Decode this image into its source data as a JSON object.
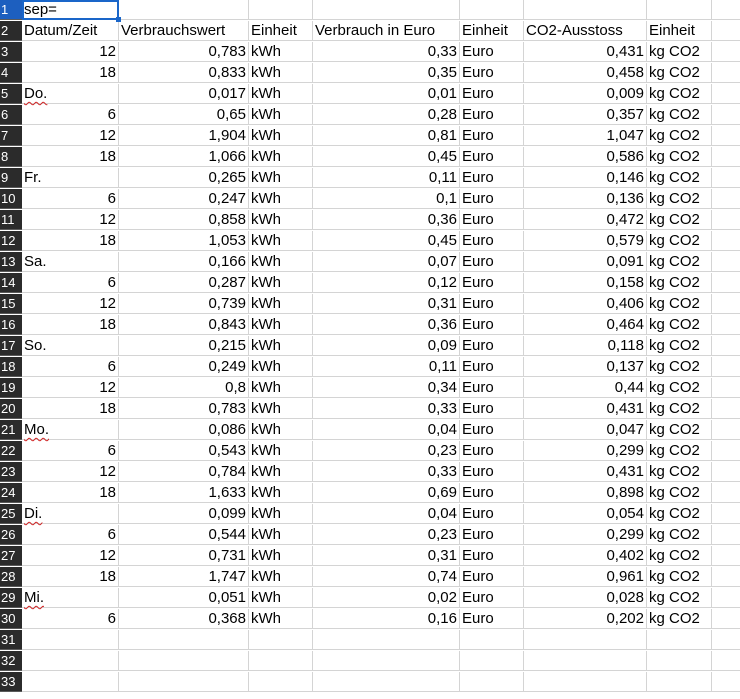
{
  "sheet": {
    "row_numbers": [
      "1",
      "2",
      "3",
      "4",
      "5",
      "6",
      "7",
      "8",
      "9",
      "10",
      "11",
      "12",
      "13",
      "14",
      "15",
      "16",
      "17",
      "18",
      "19",
      "20",
      "21",
      "22",
      "23",
      "24",
      "25",
      "26",
      "27",
      "28",
      "29",
      "30",
      "31",
      "32",
      "33"
    ],
    "rows": [
      [
        "sep=",
        "",
        "",
        "",
        "",
        "",
        "",
        ""
      ],
      [
        "Datum/Zeit",
        "Verbrauchswert",
        "Einheit",
        "Verbrauch in Euro",
        "Einheit",
        "CO2-Ausstoss",
        "Einheit",
        ""
      ],
      [
        "12",
        "0,783",
        "kWh",
        "0,33",
        "Euro",
        "0,431",
        "kg CO2",
        ""
      ],
      [
        "18",
        "0,833",
        "kWh",
        "0,35",
        "Euro",
        "0,458",
        "kg CO2",
        ""
      ],
      [
        "Do.",
        "0,017",
        "kWh",
        "0,01",
        "Euro",
        "0,009",
        "kg CO2",
        ""
      ],
      [
        "6",
        "0,65",
        "kWh",
        "0,28",
        "Euro",
        "0,357",
        "kg CO2",
        ""
      ],
      [
        "12",
        "1,904",
        "kWh",
        "0,81",
        "Euro",
        "1,047",
        "kg CO2",
        ""
      ],
      [
        "18",
        "1,066",
        "kWh",
        "0,45",
        "Euro",
        "0,586",
        "kg CO2",
        ""
      ],
      [
        "Fr.",
        "0,265",
        "kWh",
        "0,11",
        "Euro",
        "0,146",
        "kg CO2",
        ""
      ],
      [
        "6",
        "0,247",
        "kWh",
        "0,1",
        "Euro",
        "0,136",
        "kg CO2",
        ""
      ],
      [
        "12",
        "0,858",
        "kWh",
        "0,36",
        "Euro",
        "0,472",
        "kg CO2",
        ""
      ],
      [
        "18",
        "1,053",
        "kWh",
        "0,45",
        "Euro",
        "0,579",
        "kg CO2",
        ""
      ],
      [
        "Sa.",
        "0,166",
        "kWh",
        "0,07",
        "Euro",
        "0,091",
        "kg CO2",
        ""
      ],
      [
        "6",
        "0,287",
        "kWh",
        "0,12",
        "Euro",
        "0,158",
        "kg CO2",
        ""
      ],
      [
        "12",
        "0,739",
        "kWh",
        "0,31",
        "Euro",
        "0,406",
        "kg CO2",
        ""
      ],
      [
        "18",
        "0,843",
        "kWh",
        "0,36",
        "Euro",
        "0,464",
        "kg CO2",
        ""
      ],
      [
        "So.",
        "0,215",
        "kWh",
        "0,09",
        "Euro",
        "0,118",
        "kg CO2",
        ""
      ],
      [
        "6",
        "0,249",
        "kWh",
        "0,11",
        "Euro",
        "0,137",
        "kg CO2",
        ""
      ],
      [
        "12",
        "0,8",
        "kWh",
        "0,34",
        "Euro",
        "0,44",
        "kg CO2",
        ""
      ],
      [
        "18",
        "0,783",
        "kWh",
        "0,33",
        "Euro",
        "0,431",
        "kg CO2",
        ""
      ],
      [
        "Mo.",
        "0,086",
        "kWh",
        "0,04",
        "Euro",
        "0,047",
        "kg CO2",
        ""
      ],
      [
        "6",
        "0,543",
        "kWh",
        "0,23",
        "Euro",
        "0,299",
        "kg CO2",
        ""
      ],
      [
        "12",
        "0,784",
        "kWh",
        "0,33",
        "Euro",
        "0,431",
        "kg CO2",
        ""
      ],
      [
        "18",
        "1,633",
        "kWh",
        "0,69",
        "Euro",
        "0,898",
        "kg CO2",
        ""
      ],
      [
        "Di.",
        "0,099",
        "kWh",
        "0,04",
        "Euro",
        "0,054",
        "kg CO2",
        ""
      ],
      [
        "6",
        "0,544",
        "kWh",
        "0,23",
        "Euro",
        "0,299",
        "kg CO2",
        ""
      ],
      [
        "12",
        "0,731",
        "kWh",
        "0,31",
        "Euro",
        "0,402",
        "kg CO2",
        ""
      ],
      [
        "18",
        "1,747",
        "kWh",
        "0,74",
        "Euro",
        "0,961",
        "kg CO2",
        ""
      ],
      [
        "Mi.",
        "0,051",
        "kWh",
        "0,02",
        "Euro",
        "0,028",
        "kg CO2",
        ""
      ],
      [
        "6",
        "0,368",
        "kWh",
        "0,16",
        "Euro",
        "0,202",
        "kg CO2",
        ""
      ],
      [
        "",
        "",
        "",
        "",
        "",
        "",
        "",
        ""
      ],
      [
        "",
        "",
        "",
        "",
        "",
        "",
        "",
        ""
      ],
      [
        "",
        "",
        "",
        "",
        "",
        "",
        "",
        ""
      ]
    ],
    "active_cell": "A1",
    "colors": {
      "selection": "#1a66c9",
      "row_header_bg": "#2b2b2b",
      "active_row_header_bg": "#1d5fbf",
      "grid": "#d4d4d4",
      "spellcheck": "#d02020"
    }
  }
}
